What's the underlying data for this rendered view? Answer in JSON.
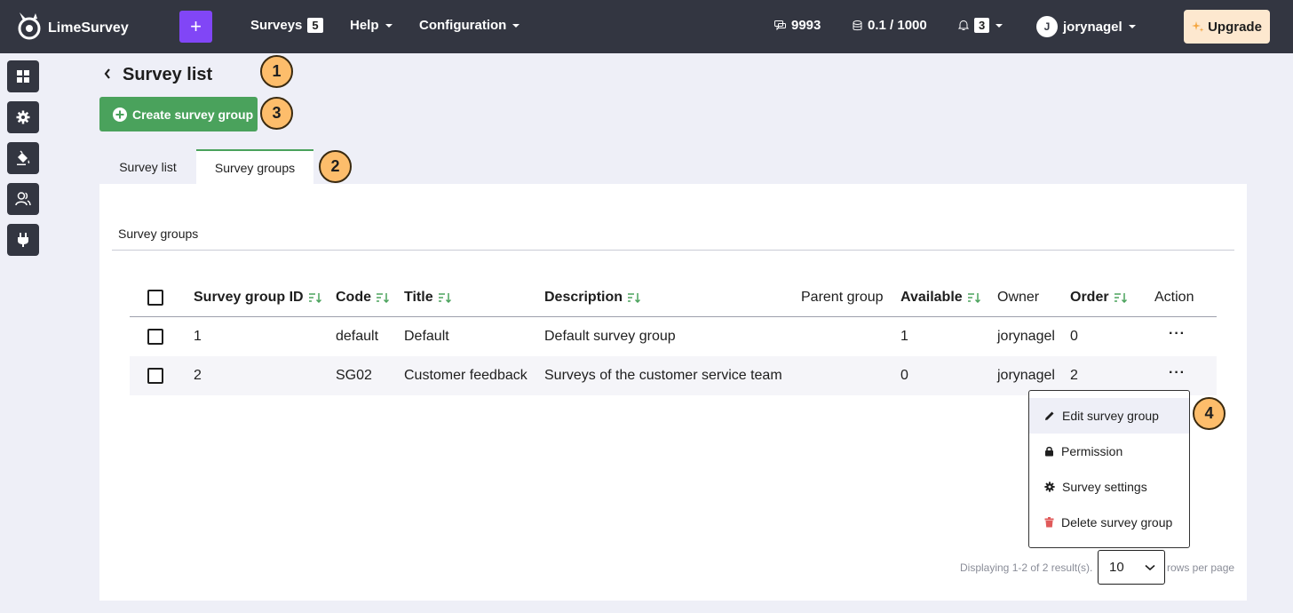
{
  "topbar": {
    "app_name": "LimeSurvey",
    "plus_label": "+",
    "surveys_label": "Surveys",
    "surveys_count": "5",
    "help_label": "Help",
    "configuration_label": "Configuration",
    "responses_count": "9993",
    "storage_usage": "0.1 / 1000",
    "notifications_count": "3",
    "user_initial": "J",
    "username": "jorynagel",
    "upgrade_label": "Upgrade"
  },
  "sidebar": {
    "items": [
      "dashboard-icon",
      "settings-icon",
      "theme-icon",
      "users-icon",
      "plugin-icon"
    ]
  },
  "header": {
    "title": "Survey list",
    "create_button": "Create survey group"
  },
  "markers": [
    "1",
    "2",
    "3",
    "4"
  ],
  "tabs": [
    {
      "label": "Survey list",
      "active": false
    },
    {
      "label": "Survey groups",
      "active": true
    }
  ],
  "section": {
    "label": "Survey groups"
  },
  "table": {
    "headers": [
      "Survey group ID",
      "Code",
      "Title",
      "Description",
      "Parent group",
      "Available",
      "Owner",
      "Order",
      "Action"
    ],
    "rows": [
      {
        "id": "1",
        "code": "default",
        "title": "Default",
        "description": "Default survey group",
        "parent": "",
        "available": "1",
        "owner": "jorynagel",
        "order": "0",
        "action": "···"
      },
      {
        "id": "2",
        "code": "SG02",
        "title": "Customer feedback",
        "description": "Surveys of the customer service team",
        "parent": "",
        "available": "0",
        "owner": "jorynagel",
        "order": "2",
        "action": "···"
      }
    ]
  },
  "action_menu": {
    "items": [
      "Edit survey group",
      "Permission",
      "Survey settings",
      "Delete survey group"
    ]
  },
  "pagination": {
    "summary": "Displaying 1-2 of 2 result(s).",
    "page_size": "10",
    "suffix": "rows per page"
  },
  "colors": {
    "topbar": "#333641",
    "accent_purple": "#8146f6",
    "green": "#4aa25c",
    "marker": "#fdbd6b",
    "upgrade_bg": "#fde8cf",
    "delete_red": "#e05a5a"
  }
}
